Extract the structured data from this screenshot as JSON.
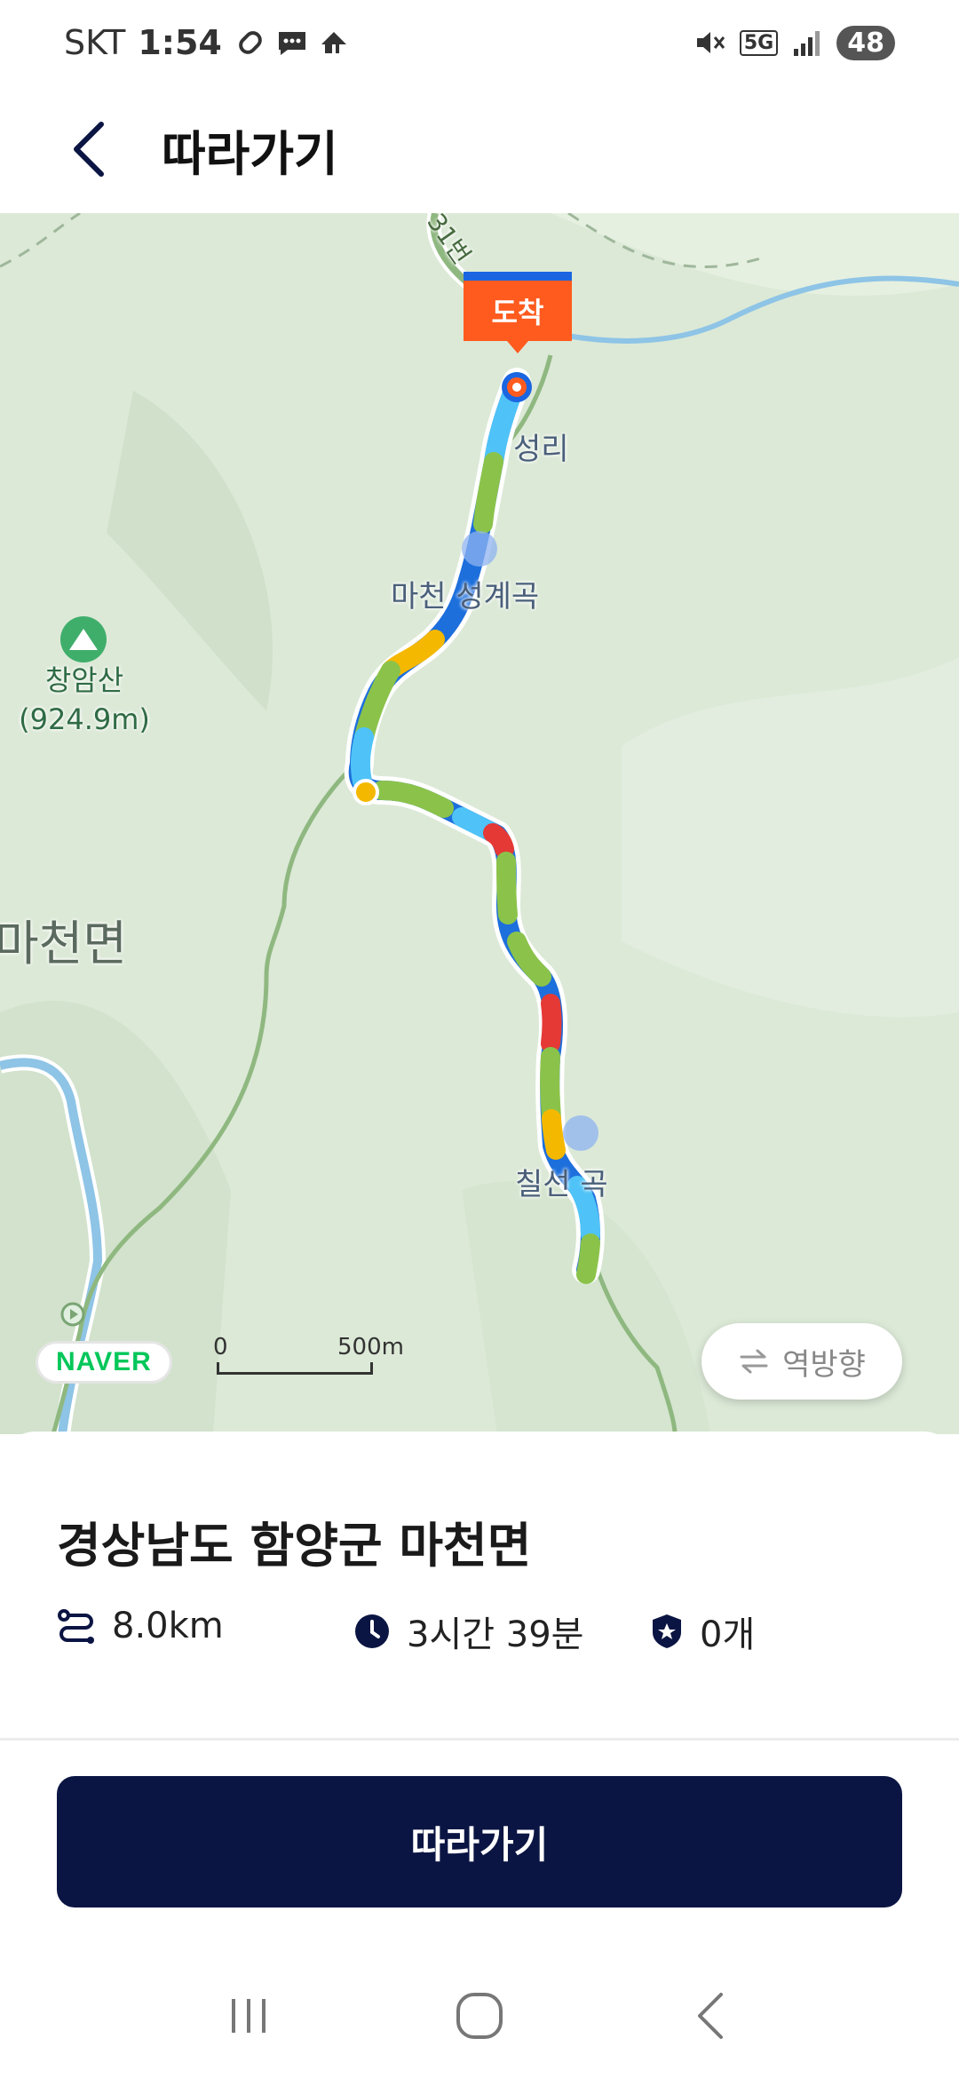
{
  "status_bar": {
    "carrier": "SKT",
    "time": "1:54",
    "network": "5G",
    "battery": "48"
  },
  "header": {
    "title": "따라가기"
  },
  "map": {
    "arrival_flag": "도착",
    "labels": {
      "village": "성리",
      "valley_top": "마천 성계곡",
      "mountain_name": "창암산",
      "mountain_height": "(924.9m)",
      "township": "마천면",
      "valley_bottom": "칠선 곡",
      "road": "31번"
    },
    "provider": "NAVER",
    "scale": {
      "zero": "0",
      "max": "500m"
    },
    "reverse_label": "역방향"
  },
  "sheet": {
    "region": "경상남도 함양군 마천면",
    "distance": "8.0km",
    "duration": "3시간 39분",
    "count": "0개"
  },
  "primary_action": {
    "label": "따라가기"
  },
  "colors": {
    "primary": "#0b1543",
    "arrival": "#ff5b1e",
    "map_bg": "#dbe8d6"
  }
}
